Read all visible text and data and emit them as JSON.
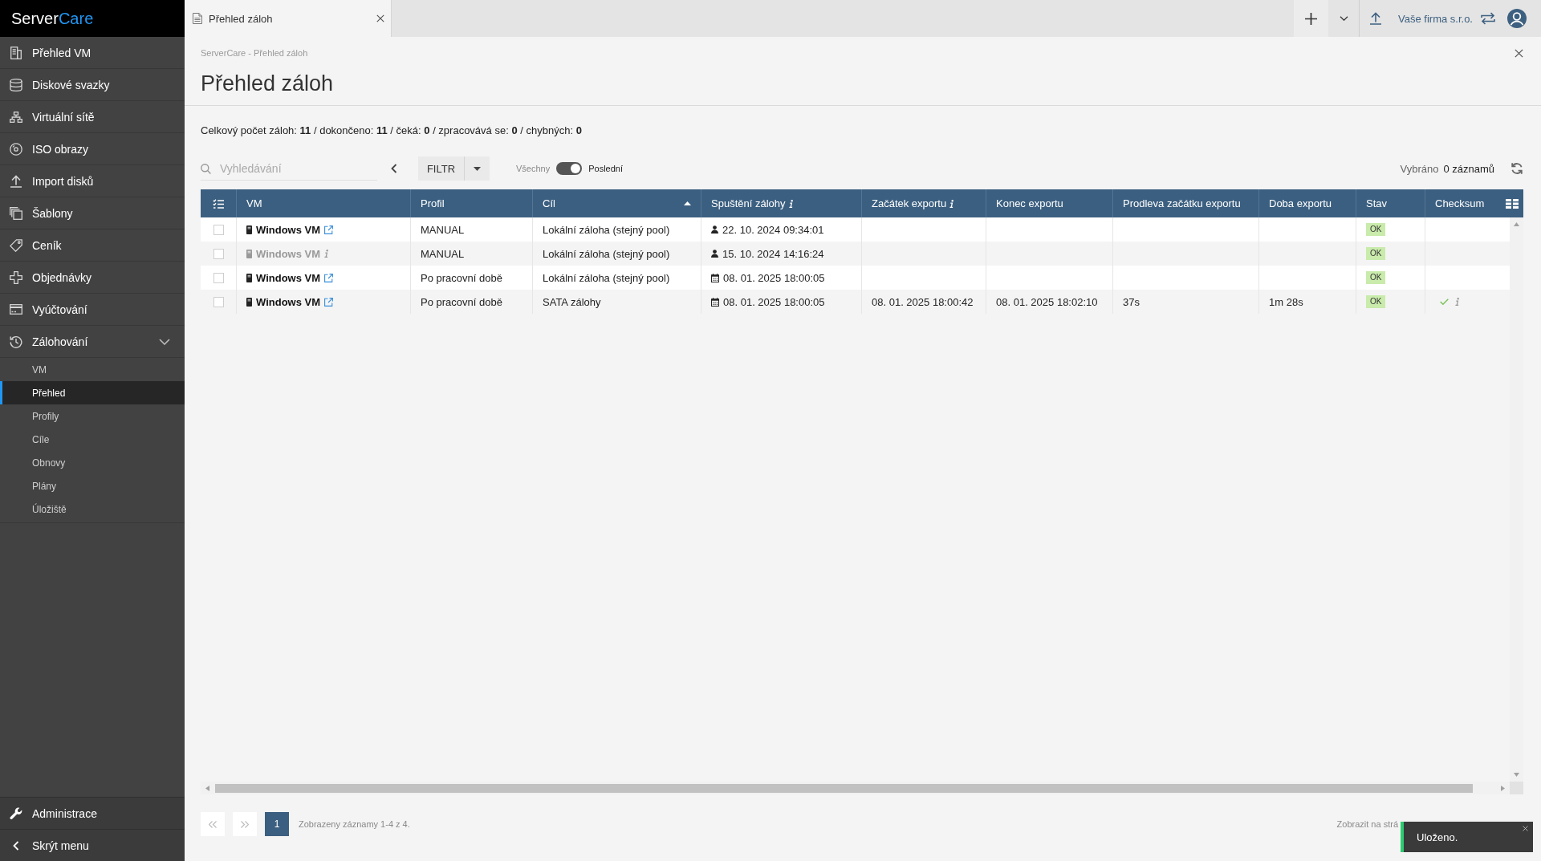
{
  "sidebar": {
    "logo": {
      "name": "Server",
      "accent": "Care"
    },
    "items": [
      {
        "label": "Přehled VM",
        "selected": false
      },
      {
        "label": "Diskové svazky",
        "selected": false
      },
      {
        "label": "Virtuální sítě",
        "selected": false
      },
      {
        "label": "ISO obrazy",
        "selected": false
      },
      {
        "label": "Import disků",
        "selected": false
      },
      {
        "label": "Šablony",
        "selected": false
      },
      {
        "label": "Ceník",
        "selected": false
      },
      {
        "label": "Objednávky",
        "selected": false
      },
      {
        "label": "Vyúčtování",
        "selected": false
      },
      {
        "label": "Zálohování",
        "selected": false,
        "expanded": true,
        "children": [
          {
            "label": "VM",
            "selected": false
          },
          {
            "label": "Přehled",
            "selected": true
          },
          {
            "label": "Profily",
            "selected": false
          },
          {
            "label": "Cíle",
            "selected": false
          },
          {
            "label": "Obnovy",
            "selected": false
          },
          {
            "label": "Plány",
            "selected": false
          },
          {
            "label": "Úložiště",
            "selected": false
          }
        ]
      }
    ],
    "footer_items": [
      {
        "label": "Administrace"
      },
      {
        "label": "Skrýt menu"
      }
    ]
  },
  "top_bar": {
    "tabs": [
      {
        "label": "Přehled záloh",
        "selected": true
      }
    ],
    "company": "Vaše firma s.r.o."
  },
  "page": {
    "breadcrumb": "ServerCare - Přehled záloh",
    "title": "Přehled záloh",
    "summary": "Celkový počet záloh: **11** / dokončeno: **11** / čeká: **0** / zpracovává se: **0** / chybných: **0**"
  },
  "toolbar": {
    "search": {
      "placeholder": "Vyhledávání"
    },
    "filter_button": "FILTR",
    "toggle": {
      "off_label": "Všechny",
      "on_label": "Poslední",
      "on": true
    },
    "selection_label": "Vybráno",
    "selection_count": "0 záznamů"
  },
  "table": {
    "columns": [
      {
        "label": "VM",
        "sorted": false,
        "info": false
      },
      {
        "label": "Profil",
        "sorted": false,
        "info": false
      },
      {
        "label": "Cíl",
        "sorted": true,
        "info": false
      },
      {
        "label": "Spuštění zálohy",
        "sorted": false,
        "info": true
      },
      {
        "label": "Začátek exportu",
        "sorted": false,
        "info": true
      },
      {
        "label": "Konec exportu",
        "sorted": false,
        "info": false
      },
      {
        "label": "Prodleva začátku exportu",
        "sorted": false,
        "info": false
      },
      {
        "label": "Doba exportu",
        "sorted": false,
        "info": false
      },
      {
        "label": "Stav",
        "sorted": false,
        "info": false
      },
      {
        "label": "Checksum",
        "sorted": false,
        "info": false
      }
    ],
    "rows": [
      {
        "checked": false,
        "vm": {
          "name": "Windows VM",
          "disabled": false
        },
        "profile": "MANUAL",
        "target": "Lokální záloha (stejný pool)",
        "started": {
          "kind": "manual",
          "time": "22. 10. 2024 09:34:01"
        },
        "status": "OK",
        "checksum_ok": false
      },
      {
        "checked": false,
        "vm": {
          "name": "Windows VM",
          "disabled": true
        },
        "profile": "MANUAL",
        "target": "Lokální záloha (stejný pool)",
        "started": {
          "kind": "manual",
          "time": "15. 10. 2024 14:16:24"
        },
        "status": "OK",
        "checksum_ok": false
      },
      {
        "checked": false,
        "vm": {
          "name": "Windows VM",
          "disabled": false
        },
        "profile": "Po pracovní době",
        "target": "Lokální záloha (stejný pool)",
        "started": {
          "kind": "scheduled",
          "time": "08. 01. 2025 18:00:05"
        },
        "status": "OK",
        "checksum_ok": false
      },
      {
        "checked": false,
        "vm": {
          "name": "Windows VM",
          "disabled": false
        },
        "profile": "Po pracovní době",
        "target": "SATA zálohy",
        "started": {
          "kind": "scheduled",
          "time": "08. 01. 2025 18:00:05"
        },
        "export_start": "08. 01. 2025 18:00:42",
        "export_end": "08. 01. 2025 18:02:10",
        "export_delay": "37s",
        "export_duration": "1m 28s",
        "status": "OK",
        "checksum_ok": true
      }
    ]
  },
  "pagination": {
    "pages": [
      {
        "label": "1",
        "selected": true
      }
    ],
    "summary": "Zobrazeny záznamy 1-4 z 4.",
    "page_size_label": "Zobrazit na strá"
  },
  "toast": {
    "message": "Uloženo."
  }
}
